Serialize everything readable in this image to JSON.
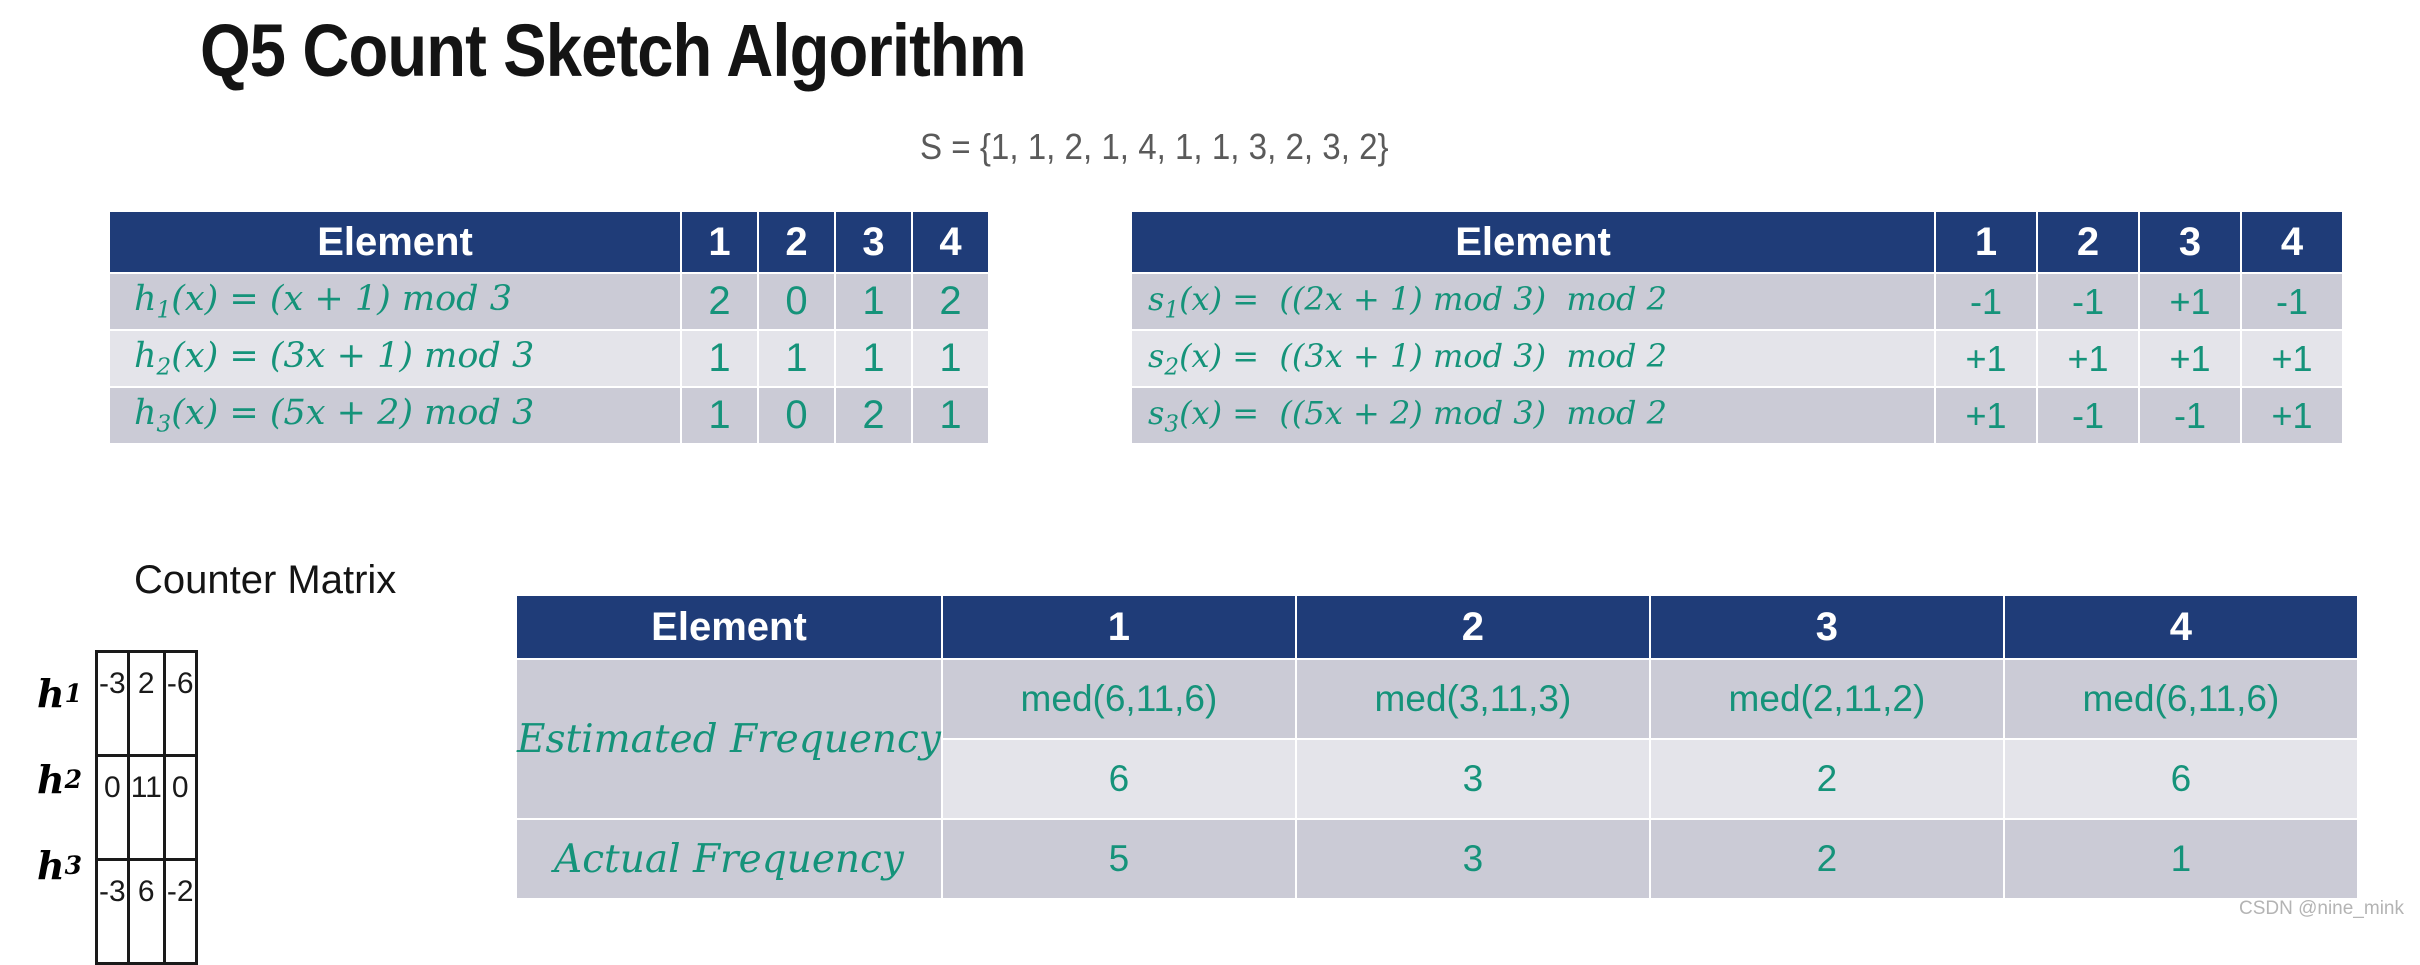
{
  "title": "Q5 Count Sketch Algorithm",
  "stream": "S = {1, 1, 2, 1, 4, 1, 1, 3, 2, 3, 2}",
  "colors": {
    "header_blue": "#1F3C78",
    "accent_green": "#15937A",
    "row_dark": "#CBCBD6",
    "row_light": "#E4E4EA",
    "title_black": "#141414",
    "subtitle_gray": "#5A5A5A"
  },
  "hash_table": {
    "header": {
      "element": "Element",
      "cols": [
        "1",
        "2",
        "3",
        "4"
      ]
    },
    "rows": [
      {
        "name": "h1",
        "formula_plain": "h₁(x) = (x + 1) mod 3",
        "fn": "h",
        "sub": "1",
        "arg": "(x)",
        "eq": "=",
        "expr": "(x + 1)",
        "modtext": "mod 3",
        "values": [
          "2",
          "0",
          "1",
          "2"
        ]
      },
      {
        "name": "h2",
        "formula_plain": "h₂(x) = (3x + 1) mod 3",
        "fn": "h",
        "sub": "2",
        "arg": "(x)",
        "eq": "=",
        "expr": "(3x + 1)",
        "modtext": "mod 3",
        "values": [
          "1",
          "1",
          "1",
          "1"
        ]
      },
      {
        "name": "h3",
        "formula_plain": "h₃(x) = (5x + 2) mod 3",
        "fn": "h",
        "sub": "3",
        "arg": "(x)",
        "eq": "=",
        "expr": "(5x + 2)",
        "modtext": "mod 3",
        "values": [
          "1",
          "0",
          "2",
          "1"
        ]
      }
    ]
  },
  "sign_table": {
    "header": {
      "element": "Element",
      "cols": [
        "1",
        "2",
        "3",
        "4"
      ]
    },
    "rows": [
      {
        "name": "s1",
        "formula_plain": "s₁(x) =  ((2x + 1) mod 3)  mod 2",
        "fn": "s",
        "sub": "1",
        "arg": "(x)",
        "eq": "=",
        "expr": "((2x + 1)",
        "modtext": "mod 3)",
        "modtext2": "mod 2",
        "values": [
          "-1",
          "-1",
          "+1",
          "-1"
        ]
      },
      {
        "name": "s2",
        "formula_plain": "s₂(x) =  ((3x + 1) mod 3)  mod 2",
        "fn": "s",
        "sub": "2",
        "arg": "(x)",
        "eq": "=",
        "expr": "((3x + 1)",
        "modtext": "mod 3)",
        "modtext2": "mod 2",
        "values": [
          "+1",
          "+1",
          "+1",
          "+1"
        ]
      },
      {
        "name": "s3",
        "formula_plain": "s₃(x) =  ((5x + 2) mod 3)  mod 2",
        "fn": "s",
        "sub": "3",
        "arg": "(x)",
        "eq": "=",
        "expr": "((5x + 2)",
        "modtext": "mod 3)",
        "modtext2": "mod 2",
        "values": [
          "+1",
          "-1",
          "-1",
          "+1"
        ]
      }
    ]
  },
  "counter_matrix": {
    "title": "Counter Matrix",
    "row_labels": [
      {
        "fn": "h",
        "sub": "1"
      },
      {
        "fn": "h",
        "sub": "2"
      },
      {
        "fn": "h",
        "sub": "3"
      }
    ],
    "cells": [
      [
        "-3",
        "2",
        "-6"
      ],
      [
        "0",
        "11",
        "0"
      ],
      [
        "-3",
        "6",
        "-2"
      ]
    ]
  },
  "frequency_table": {
    "header": {
      "element": "Element",
      "cols": [
        "1",
        "2",
        "3",
        "4"
      ]
    },
    "estimated_label": "Estimated Frequency",
    "actual_label": "Actual Frequency",
    "estimated_expr": [
      "med(6,11,6)",
      "med(3,11,3)",
      "med(2,11,2)",
      "med(6,11,6)"
    ],
    "estimated_value": [
      "6",
      "3",
      "2",
      "6"
    ],
    "actual_value": [
      "5",
      "3",
      "2",
      "1"
    ]
  },
  "watermark": "CSDN @nine_mink"
}
